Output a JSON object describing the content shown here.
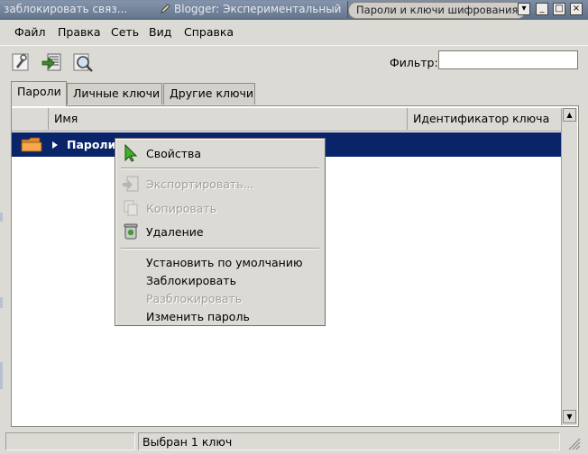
{
  "titlebar": {
    "bg_tab1": "заблокировать связ...",
    "bg_tab2": "Blogger: Экспериментальный",
    "window_title": "Пароли и ключи шифрования"
  },
  "menubar": {
    "file": "Файл",
    "edit": "Правка",
    "network": "Сеть",
    "view": "Вид",
    "help": "Справка"
  },
  "toolbar": {
    "properties_icon": "key-properties-icon",
    "export_icon": "export-icon",
    "search_icon": "search-icon",
    "filter_label": "Фильтр:",
    "filter_value": ""
  },
  "tabs": [
    "Пароли",
    "Личные ключи",
    "Другие ключи"
  ],
  "columns": {
    "name": "Имя",
    "key_id": "Идентификатор ключа"
  },
  "rows": [
    {
      "name": "Пароли:",
      "icon": "folder-icon",
      "selected": true
    }
  ],
  "context_menu": {
    "items": [
      {
        "label": "Свойства",
        "enabled": true,
        "icon": "cursor-arrow-icon"
      },
      {
        "label": "Экспортировать...",
        "enabled": false,
        "icon": "export-icon"
      },
      {
        "label": "Копировать",
        "enabled": false,
        "icon": "copy-icon"
      },
      {
        "label": "Удаление",
        "enabled": true,
        "icon": "trash-icon"
      },
      {
        "label": "Установить по умолчанию",
        "enabled": true
      },
      {
        "label": "Заблокировать",
        "enabled": true
      },
      {
        "label": "Разблокировать",
        "enabled": false
      },
      {
        "label": "Изменить пароль",
        "enabled": true
      }
    ]
  },
  "status": {
    "text": "Выбран 1 ключ"
  },
  "colors": {
    "selection": "#0a246a",
    "window_bg": "#dcdad5",
    "titlebar": "#6b7b93"
  }
}
